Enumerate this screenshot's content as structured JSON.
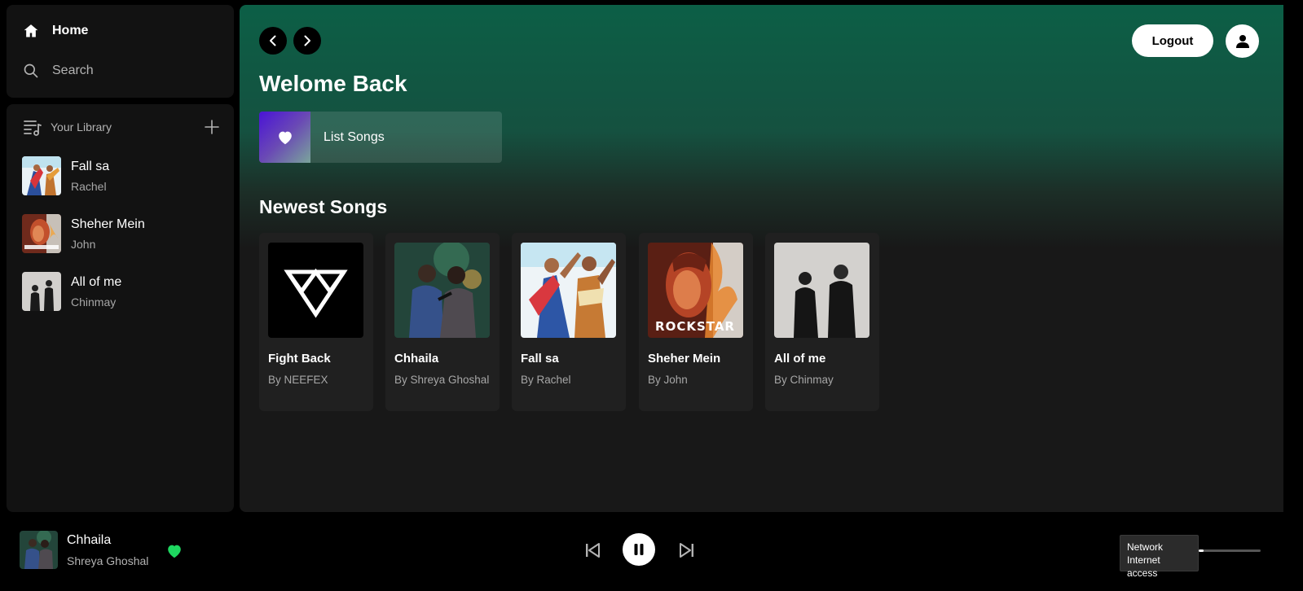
{
  "sidebar": {
    "nav": {
      "home_label": "Home",
      "search_label": "Search"
    },
    "library": {
      "title": "Your Library",
      "items": [
        {
          "title": "Fall sa",
          "artist": "Rachel"
        },
        {
          "title": "Sheher Mein",
          "artist": "John"
        },
        {
          "title": "All of me",
          "artist": "Chinmay"
        }
      ]
    }
  },
  "header": {
    "logout_label": "Logout"
  },
  "main": {
    "welcome": "Welome Back",
    "list_songs_label": "List Songs",
    "newest_title": "Newest Songs",
    "songs": [
      {
        "title": "Fight Back",
        "artist": "By NEEFEX"
      },
      {
        "title": "Chhaila",
        "artist": "By Shreya Ghoshal"
      },
      {
        "title": "Fall sa",
        "artist": "By Rachel"
      },
      {
        "title": "Sheher Mein",
        "artist": "By John"
      },
      {
        "title": "All of me",
        "artist": "By Chinmay"
      }
    ]
  },
  "player": {
    "title": "Chhaila",
    "artist": "Shreya Ghoshal",
    "liked": true,
    "state": "playing",
    "volume_level": 0.08
  },
  "tooltip": {
    "line1": "Network",
    "line2": "Internet access"
  },
  "colors": {
    "accent_green": "#1ed760",
    "header_gradient_top": "#0c5f46",
    "panel_bg": "#121212",
    "card_bg": "#202020"
  },
  "icons": {
    "home": "home-icon",
    "search": "search-icon",
    "library": "library-icon",
    "plus": "plus-icon",
    "back": "chevron-left-icon",
    "forward": "chevron-right-icon",
    "user": "user-icon",
    "heart": "heart-icon",
    "prev": "skip-previous-icon",
    "pause": "pause-icon",
    "next": "skip-next-icon"
  }
}
